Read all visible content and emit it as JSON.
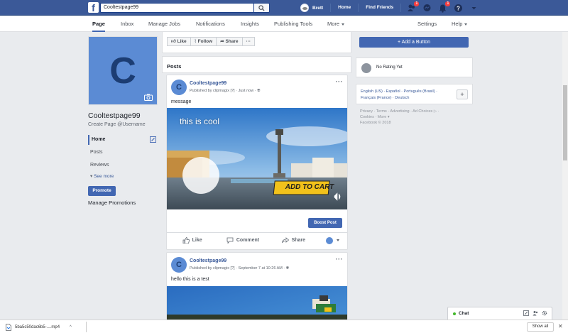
{
  "topbar": {
    "search_value": "Cooltestpage99",
    "user_name": "Brett",
    "home": "Home",
    "find_friends": "Find Friends",
    "friend_badge": "1",
    "notif_badge": "1"
  },
  "pagenav": {
    "tabs": [
      "Page",
      "Inbox",
      "Manage Jobs",
      "Notifications",
      "Insights",
      "Publishing Tools",
      "More"
    ],
    "settings": "Settings",
    "help": "Help"
  },
  "left": {
    "avatar_letter": "C",
    "page_name": "Cooltestpage99",
    "create_username": "Create Page @Username",
    "nav": [
      "Home",
      "Posts",
      "Reviews"
    ],
    "see_more": "See more",
    "promote": "Promote",
    "manage_promotions": "Manage Promotions"
  },
  "actions": {
    "like": "Like",
    "follow": "Follow",
    "share": "Share",
    "more": "···"
  },
  "posts_title": "Posts",
  "posts": [
    {
      "avatar": "C",
      "name": "Cooltestpage99",
      "meta": "Published by clipmagix [?] · Just now ·",
      "text": "message",
      "overlay_text": "this is cool",
      "cta": "ADD TO CART",
      "boost": "Boost Post",
      "like": "Like",
      "comment": "Comment",
      "share": "Share"
    },
    {
      "avatar": "C",
      "name": "Cooltestpage99",
      "meta": "Published by clipmagix [?] · September 7 at 10:26 AM ·",
      "text": "hello this is a test"
    }
  ],
  "right": {
    "add_button": "+ Add a Button",
    "rating": "No Rating Yet",
    "languages_line1": "English (US) · Español · Português (Brasil) ·",
    "languages_line2": "Français (France) · Deutsch",
    "plus": "+",
    "footer_line1": "Privacy · Terms · Advertising · Ad Choices ▷ ·",
    "footer_line2": "Cookies · More ▾",
    "footer_line3": "Facebook © 2018"
  },
  "chat": {
    "label": "Chat"
  },
  "download": {
    "file": "5ba5c50dac6b5-....mp4",
    "show_all": "Show all",
    "close": "✕"
  },
  "colors": {
    "brand": "#3b5998",
    "button": "#4267b2",
    "link": "#385898"
  }
}
